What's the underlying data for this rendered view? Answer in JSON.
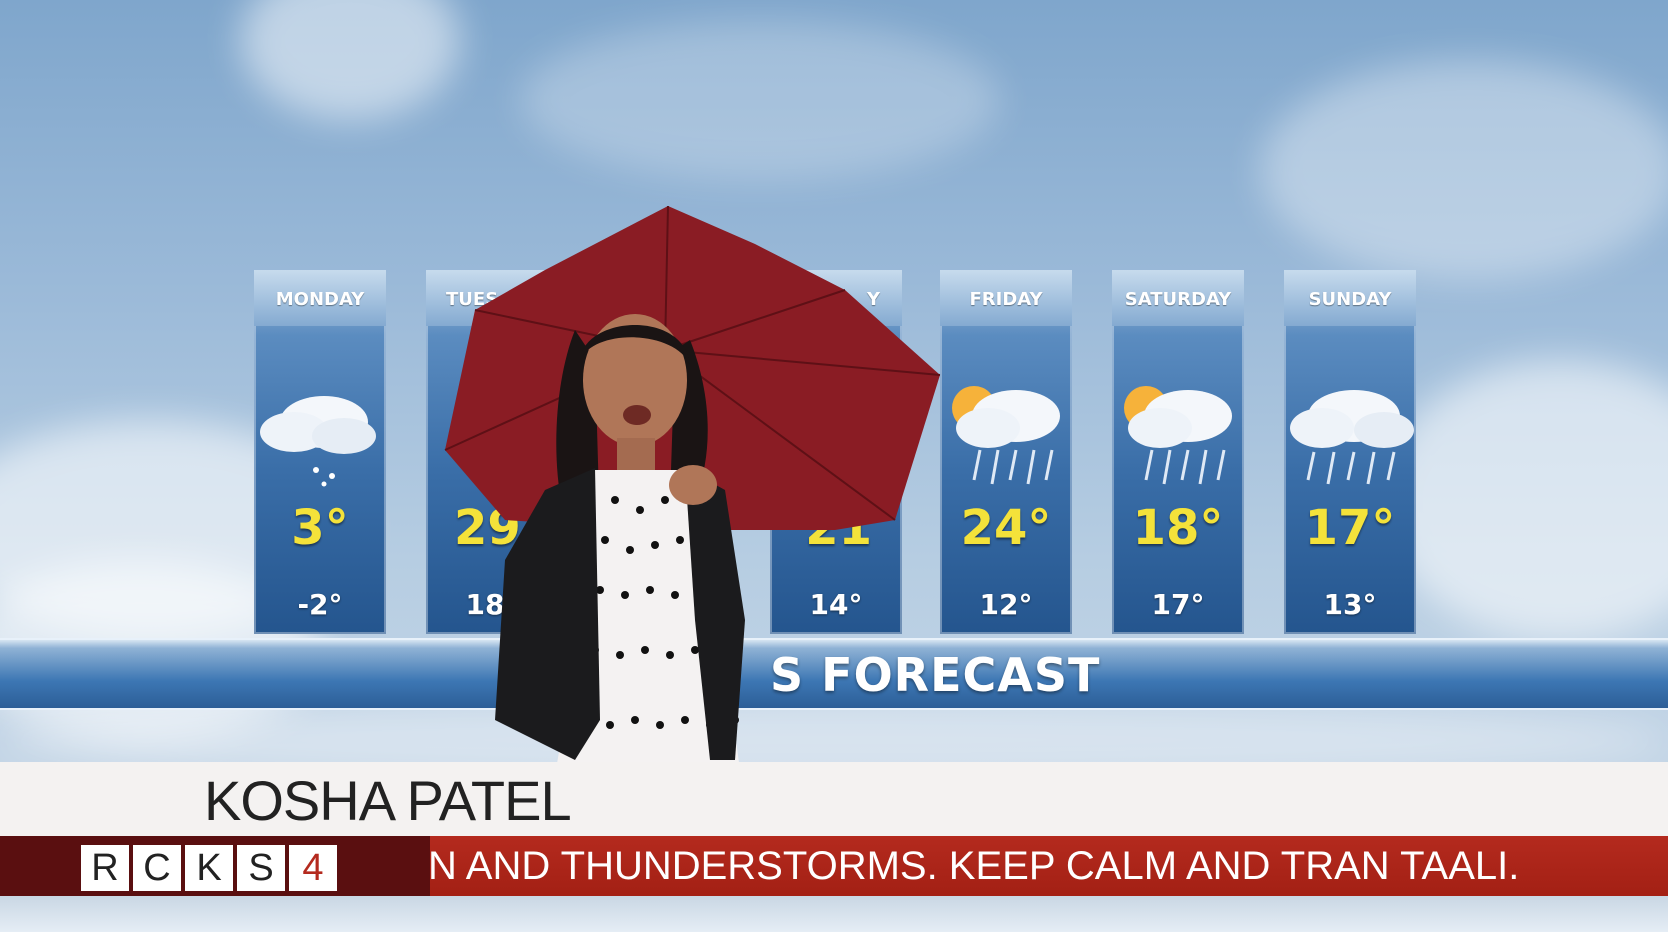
{
  "forecast": {
    "title_visible": "S FORECAST",
    "days": [
      {
        "name": "MONDAY",
        "high": "3°",
        "low": "-2°",
        "icon": "cloud-snow-icon"
      },
      {
        "name": "TUES",
        "high": "29",
        "low": "18°",
        "icon": "hidden"
      },
      {
        "name": "Y",
        "high": "21",
        "low": "14°",
        "icon": "hidden"
      },
      {
        "name": "FRIDAY",
        "high": "24°",
        "low": "12°",
        "icon": "sun-cloud-rain-icon"
      },
      {
        "name": "SATURDAY",
        "high": "18°",
        "low": "17°",
        "icon": "sun-cloud-rain-icon"
      },
      {
        "name": "SUNDAY",
        "high": "17°",
        "low": "13°",
        "icon": "cloud-rain-icon"
      }
    ]
  },
  "lower_third": {
    "presenter_name": "KOSHA PATEL",
    "ticker": "N AND THUNDERSTORMS. KEEP CALM AND TRAN TAALI.",
    "logo": [
      "R",
      "C",
      "K",
      "S",
      "4"
    ]
  },
  "colors": {
    "ticker_red": "#b42a1e",
    "logo_dark": "#5a0f10",
    "temp_yellow": "#f4e23a",
    "umbrella": "#8a1c24"
  }
}
